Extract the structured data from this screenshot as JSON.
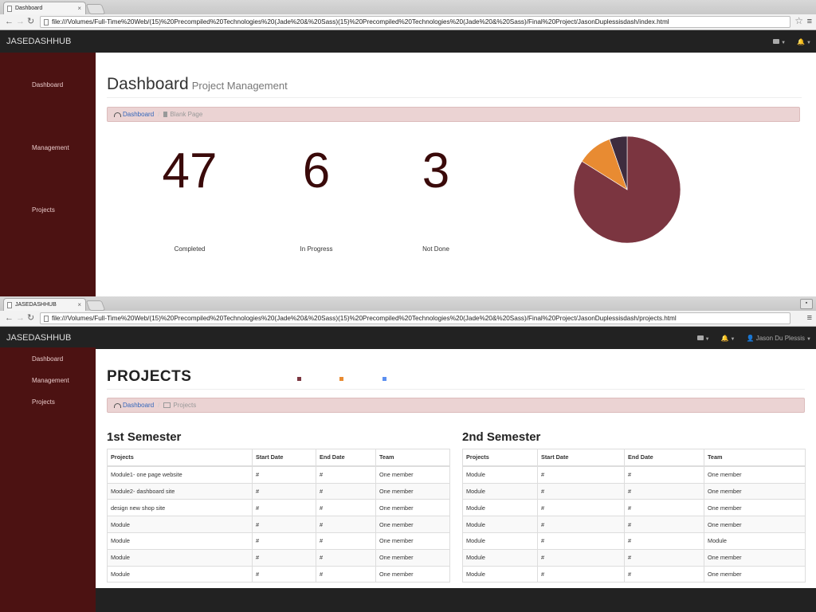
{
  "window1": {
    "tab_title": "Dashboard",
    "url": "file:///Volumes/Full-Time%20Web/(15)%20Precompiled%20Technologies%20(Jade%20&%20Sass)(15)%20Precompiled%20Technologies%20(Jade%20&%20Sass)/Final%20Project/JasonDuplessisdash/index.html",
    "brand": "JASEDASHHUB",
    "sidebar": [
      {
        "label": "Dashboard"
      },
      {
        "label": "Management"
      },
      {
        "label": "Projects"
      }
    ],
    "page_title": "Dashboard",
    "page_subtitle": "Project Management",
    "breadcrumb": {
      "home": "Dashboard",
      "current": "Blank Page"
    },
    "stats": [
      {
        "value": "47",
        "label": "Completed"
      },
      {
        "value": "6",
        "label": "In Progress"
      },
      {
        "value": "3",
        "label": "Not Done"
      }
    ]
  },
  "chart_data": {
    "type": "pie",
    "values": [
      47,
      6,
      3
    ],
    "slice_order_note": "",
    "colors": [
      "#7b3540",
      "#e88b32",
      "#3e2c3e"
    ]
  },
  "window2": {
    "tab_title": "JASEDASHHUB",
    "url": "file:///Volumes/Full-Time%20Web/(15)%20Precompiled%20Technologies%20(Jade%20&%20Sass)(15)%20Precompiled%20Technologies%20(Jade%20&%20Sass)/Final%20Project/JasonDuplessisdash/projects.html",
    "brand": "JASEDASHHUB",
    "user_name": "Jason Du Plessis",
    "sidebar": [
      {
        "label": "Dashboard"
      },
      {
        "label": "Management"
      },
      {
        "label": "Projects"
      }
    ],
    "page_title": "PROJECTS",
    "legend_colors": [
      "#7b3540",
      "#e88b32",
      "#5b8ff0"
    ],
    "breadcrumb": {
      "home": "Dashboard",
      "current": "Projects"
    },
    "sem1": {
      "title": "1st Semester",
      "headers": [
        "Projects",
        "Start Date",
        "End Date",
        "Team"
      ],
      "rows": [
        [
          "Module1- one page website",
          "#",
          "#",
          "One member"
        ],
        [
          "Module2- dashboard site",
          "#",
          "#",
          "One member"
        ],
        [
          "design new shop site",
          "#",
          "#",
          "One member"
        ],
        [
          "Module",
          "#",
          "#",
          "One member"
        ],
        [
          "Module",
          "#",
          "#",
          "One member"
        ],
        [
          "Module",
          "#",
          "#",
          "One member"
        ],
        [
          "Module",
          "#",
          "#",
          "One member"
        ]
      ]
    },
    "sem2": {
      "title": "2nd Semester",
      "headers": [
        "Projects",
        "Start Date",
        "End Date",
        "Team"
      ],
      "rows": [
        [
          "Module",
          "#",
          "#",
          "One member"
        ],
        [
          "Module",
          "#",
          "#",
          "One member"
        ],
        [
          "Module",
          "#",
          "#",
          "One member"
        ],
        [
          "Module",
          "#",
          "#",
          "One member"
        ],
        [
          "Module",
          "#",
          "#",
          "Module"
        ],
        [
          "Module",
          "#",
          "#",
          "One member"
        ],
        [
          "Module",
          "#",
          "#",
          "One member"
        ]
      ]
    }
  }
}
